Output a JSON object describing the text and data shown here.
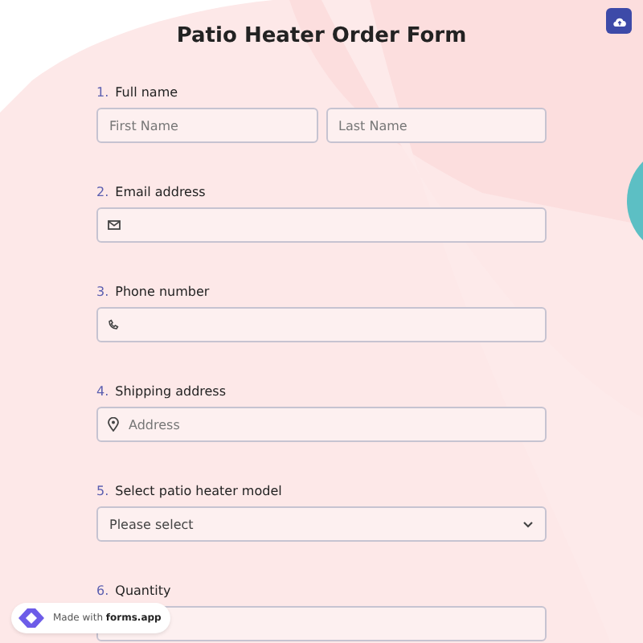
{
  "title": "Patio Heater Order Form",
  "questions": [
    {
      "number": "1.",
      "label": "Full name",
      "kind": "name",
      "placeholders": [
        "First Name",
        "Last Name"
      ]
    },
    {
      "number": "2.",
      "label": "Email address",
      "kind": "email"
    },
    {
      "number": "3.",
      "label": "Phone number",
      "kind": "phone"
    },
    {
      "number": "4.",
      "label": "Shipping address",
      "kind": "address",
      "placeholder": "Address"
    },
    {
      "number": "5.",
      "label": "Select patio heater model",
      "kind": "select",
      "value": "Please select"
    },
    {
      "number": "6.",
      "label": "Quantity",
      "kind": "number"
    }
  ],
  "badge": "Made with **forms.app**"
}
